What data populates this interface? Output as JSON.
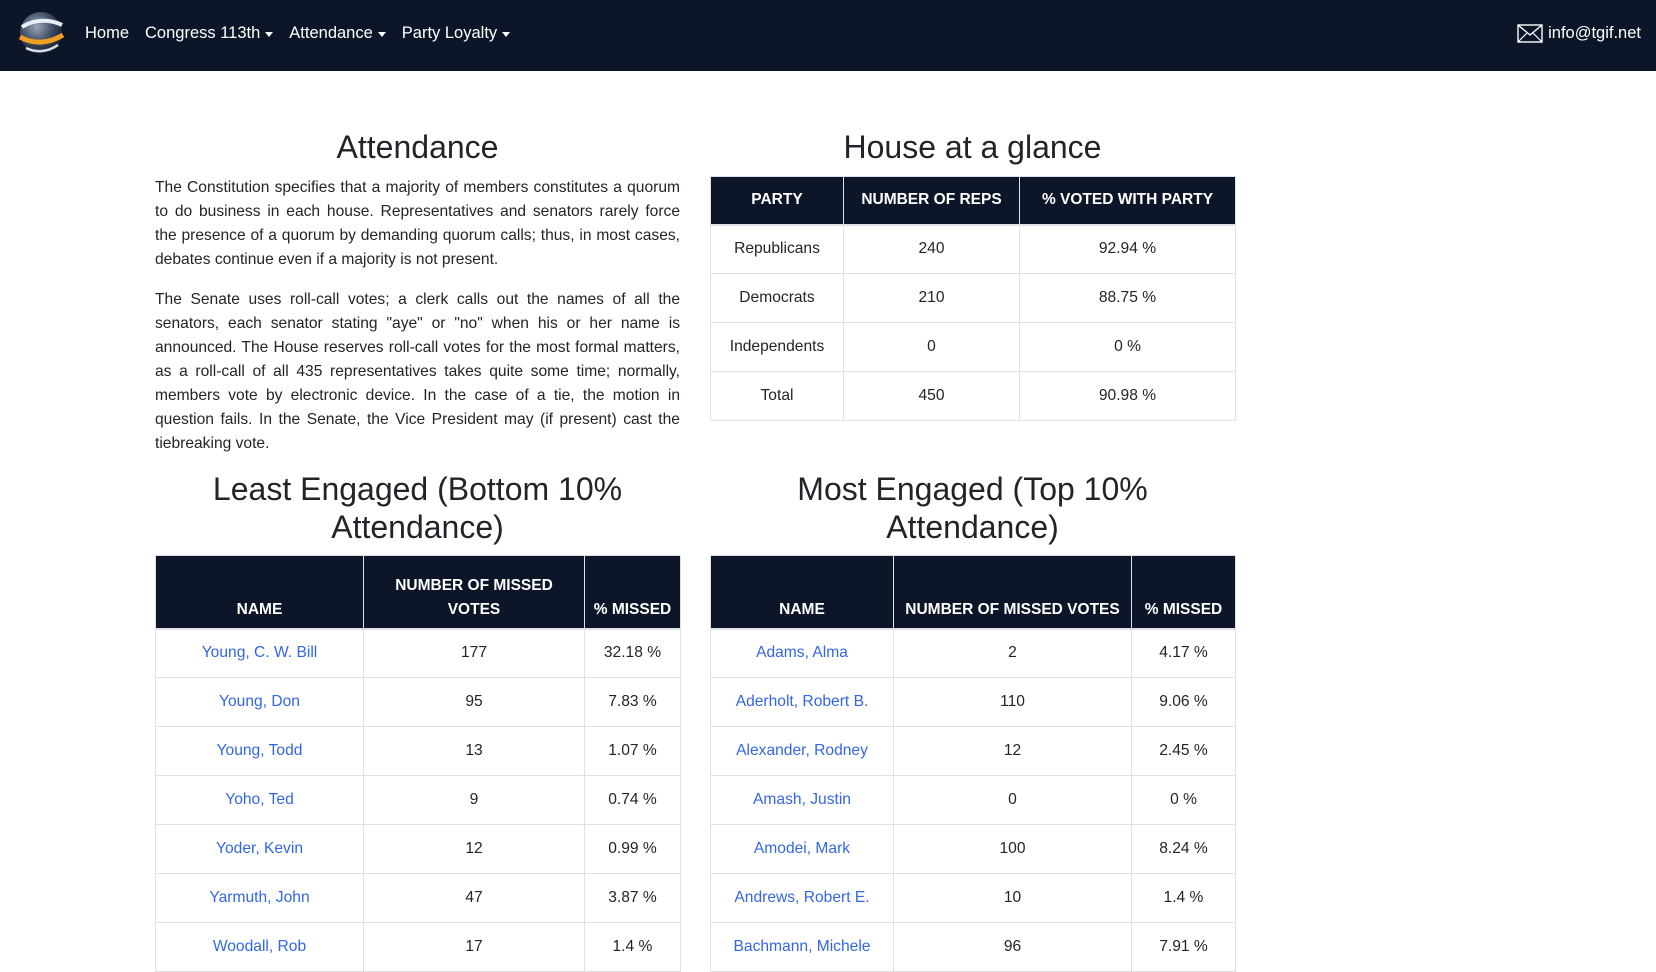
{
  "nav": {
    "items": [
      {
        "label": "Home",
        "dropdown": false
      },
      {
        "label": "Congress 113th",
        "dropdown": true
      },
      {
        "label": "Attendance",
        "dropdown": true
      },
      {
        "label": "Party Loyalty",
        "dropdown": true
      }
    ],
    "contact_email": "info@tgif.net"
  },
  "attendance": {
    "title": "Attendance",
    "paragraphs": [
      "The Constitution specifies that a majority of members constitutes a quorum to do business in each house. Representatives and senators rarely force the presence of a quorum by demanding quorum calls; thus, in most cases, debates continue even if a majority is not present.",
      "The Senate uses roll-call votes; a clerk calls out the names of all the senators, each senator stating \"aye\" or \"no\" when his or her name is announced. The House reserves roll-call votes for the most formal matters, as a roll-call of all 435 representatives takes quite some time; normally, members vote by electronic device. In the case of a tie, the motion in question fails. In the Senate, the Vice President may (if present) cast the tiebreaking vote."
    ]
  },
  "glance": {
    "title": "House at a glance",
    "headers": [
      "Party",
      "Number of Reps",
      "% Voted with Party"
    ],
    "rows": [
      [
        "Republicans",
        "240",
        "92.94 %"
      ],
      [
        "Democrats",
        "210",
        "88.75 %"
      ],
      [
        "Independents",
        "0",
        "0 %"
      ],
      [
        "Total",
        "450",
        "90.98 %"
      ]
    ]
  },
  "least_engaged": {
    "title_line1": "Least Engaged (Bottom 10%",
    "title_line2": "Attendance)",
    "headers": [
      "Name",
      "Number of Missed Votes",
      "% Missed"
    ],
    "rows": [
      [
        "Young, C. W. Bill",
        "177",
        "32.18 %"
      ],
      [
        "Young, Don",
        "95",
        "7.83 %"
      ],
      [
        "Young, Todd",
        "13",
        "1.07 %"
      ],
      [
        "Yoho, Ted",
        "9",
        "0.74 %"
      ],
      [
        "Yoder, Kevin",
        "12",
        "0.99 %"
      ],
      [
        "Yarmuth, John",
        "47",
        "3.87 %"
      ],
      [
        "Woodall, Rob",
        "17",
        "1.4 %"
      ]
    ]
  },
  "most_engaged": {
    "title_line1": "Most Engaged (Top 10%",
    "title_line2": "Attendance)",
    "headers": [
      "Name",
      "Number of Missed Votes",
      "% Missed"
    ],
    "rows": [
      [
        "Adams, Alma",
        "2",
        "4.17 %"
      ],
      [
        "Aderholt, Robert B.",
        "110",
        "9.06 %"
      ],
      [
        "Alexander, Rodney",
        "12",
        "2.45 %"
      ],
      [
        "Amash, Justin",
        "0",
        "0 %"
      ],
      [
        "Amodei, Mark",
        "100",
        "8.24 %"
      ],
      [
        "Andrews, Robert E.",
        "10",
        "1.4 %"
      ],
      [
        "Bachmann, Michele",
        "96",
        "7.91 %"
      ]
    ]
  },
  "colors": {
    "navbar_bg": "#0d1628",
    "table_header_bg": "#0d1628",
    "link": "#3366e6"
  }
}
